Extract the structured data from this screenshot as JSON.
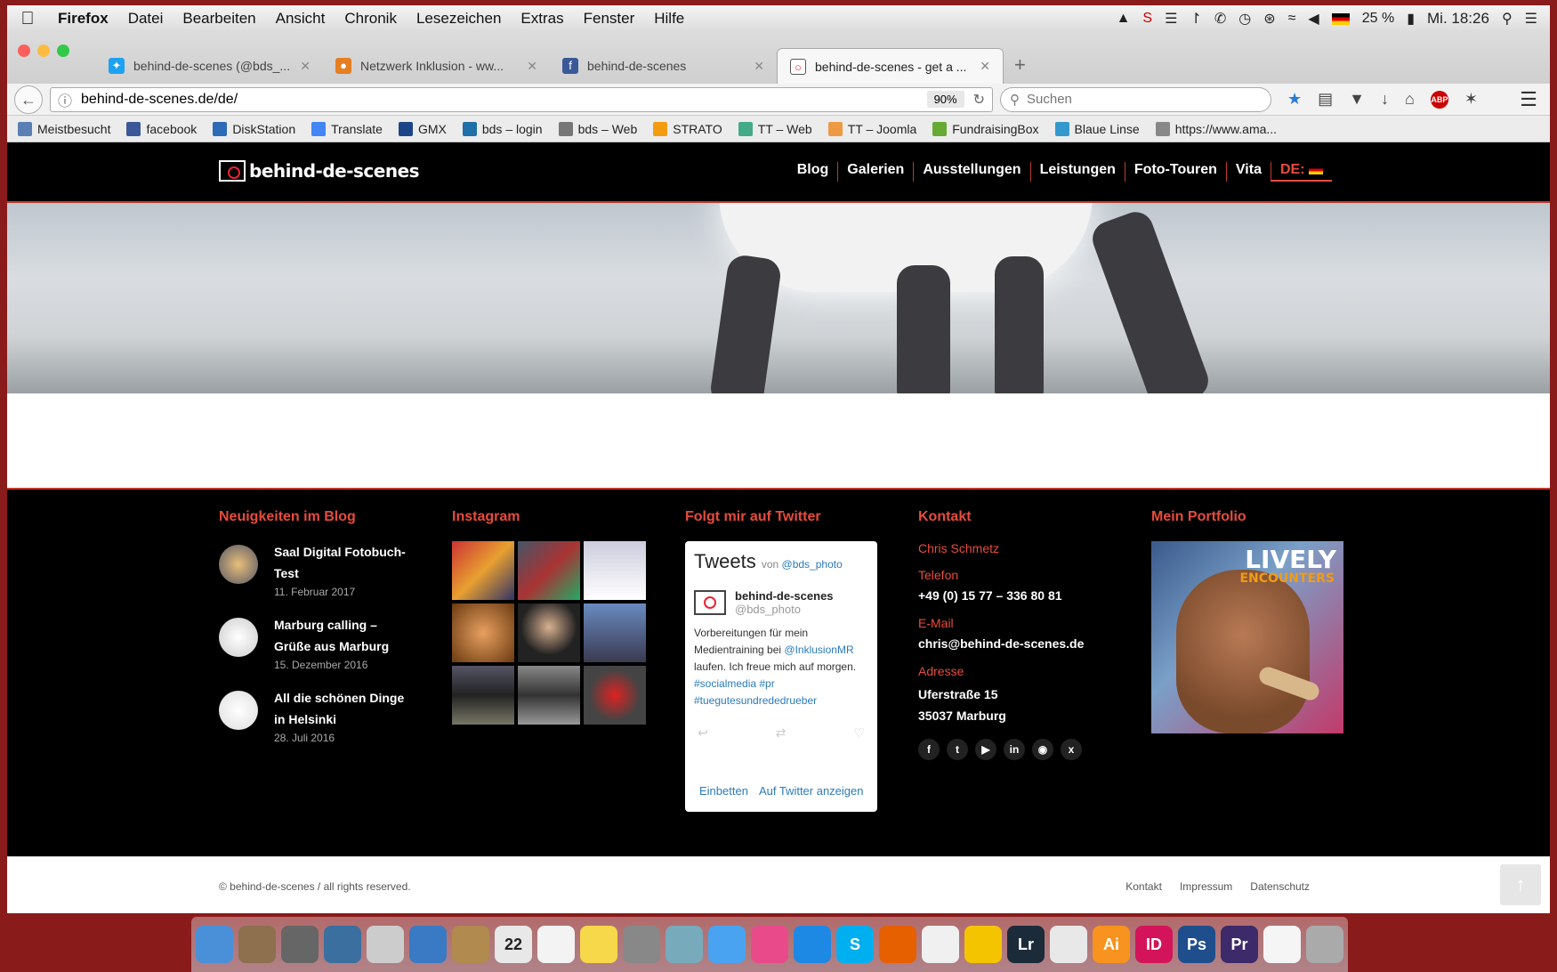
{
  "menubar": {
    "app": "Firefox",
    "items": [
      "Datei",
      "Bearbeiten",
      "Ansicht",
      "Chronik",
      "Lesezeichen",
      "Extras",
      "Fenster",
      "Hilfe"
    ],
    "battery": "25 %",
    "clock": "Mi. 18:26"
  },
  "tabs": [
    {
      "title": "behind-de-scenes (@bds_...",
      "color": "#1da1f2",
      "icon": "twitter-icon"
    },
    {
      "title": "Netzwerk Inklusion - ww...",
      "color": "#e67e22",
      "icon": "network-icon"
    },
    {
      "title": "behind-de-scenes",
      "color": "#3b5998",
      "icon": "facebook-icon"
    },
    {
      "title": "behind-de-scenes - get a ...",
      "color": "#555",
      "icon": "camera-icon",
      "active": true
    }
  ],
  "navbar": {
    "url": "behind-de-scenes.de/de/",
    "zoom": "90%",
    "search_placeholder": "Suchen"
  },
  "bookmarks": [
    {
      "label": "Meistbesucht",
      "color": "#5a7fb5"
    },
    {
      "label": "facebook",
      "color": "#3b5998"
    },
    {
      "label": "DiskStation",
      "color": "#2d6ab8"
    },
    {
      "label": "Translate",
      "color": "#4285f4"
    },
    {
      "label": "GMX",
      "color": "#1c4587"
    },
    {
      "label": "bds – login",
      "color": "#1f6fa8"
    },
    {
      "label": "bds – Web",
      "color": "#777"
    },
    {
      "label": "STRATO",
      "color": "#f39c12"
    },
    {
      "label": "TT – Web",
      "color": "#4a8"
    },
    {
      "label": "TT – Joomla",
      "color": "#e94"
    },
    {
      "label": "FundraisingBox",
      "color": "#6a3"
    },
    {
      "label": "Blaue Linse",
      "color": "#39c"
    },
    {
      "label": "https://www.ama...",
      "color": "#888"
    }
  ],
  "site": {
    "logo": "behind-de-scenes",
    "nav": [
      "Blog",
      "Galerien",
      "Ausstellungen",
      "Leistungen",
      "Foto-Touren",
      "Vita"
    ],
    "lang": "DE:"
  },
  "footer": {
    "blog_heading": "Neuigkeiten im Blog",
    "blog": [
      {
        "title": "Saal Digital Fotobuch-Test",
        "date": "11. Februar 2017"
      },
      {
        "title": "Marburg calling – Grüße aus Marburg",
        "date": "15. Dezember 2016"
      },
      {
        "title": "All die schönen Dinge in Helsinki",
        "date": "28. Juli 2016"
      }
    ],
    "instagram_heading": "Instagram",
    "twitter_heading": "Folgt mir auf Twitter",
    "twitter": {
      "title": "Tweets",
      "von": "von",
      "handle_link": "@bds_photo",
      "name": "behind-de-scenes",
      "handle": "@bds_photo",
      "text1": "Vorbereitungen für mein Medientraining bei",
      "mention": "@InklusionMR",
      "text2": "laufen. Ich freue mich auf morgen.",
      "tags": "#socialmedia #pr #tuegutesundrededrueber",
      "embed": "Einbetten",
      "view": "Auf Twitter anzeigen"
    },
    "kontakt_heading": "Kontakt",
    "kontakt": {
      "name": "Chris Schmetz",
      "tel_label": "Telefon",
      "tel": "+49 (0) 15 77 – 336 80 81",
      "mail_label": "E-Mail",
      "mail": "chris@behind-de-scenes.de",
      "addr_label": "Adresse",
      "addr1": "Uferstraße 15",
      "addr2": "35037 Marburg"
    },
    "portfolio_heading": "Mein Portfolio",
    "portfolio_title": "LIVELY",
    "portfolio_sub": "ENCOUNTERS",
    "copyright": "© behind-de-scenes / all rights reserved.",
    "links": [
      "Kontakt",
      "Impressum",
      "Datenschutz"
    ]
  },
  "dock": [
    {
      "label": "",
      "icon": "finder-icon",
      "color": "#4a90d9"
    },
    {
      "label": "",
      "icon": "photos-icon",
      "color": "#8e6f4e"
    },
    {
      "label": "",
      "icon": "launchpad-icon",
      "color": "#666"
    },
    {
      "label": "",
      "icon": "mission-control-icon",
      "color": "#3b6fa0"
    },
    {
      "label": "",
      "icon": "textedit-icon",
      "color": "#ccc"
    },
    {
      "label": "",
      "icon": "preview-icon",
      "color": "#3a7ac4"
    },
    {
      "label": "",
      "icon": "contacts-icon",
      "color": "#b08a4e"
    },
    {
      "label": "22",
      "icon": "calendar-icon",
      "color": "#e8e8e8"
    },
    {
      "label": "",
      "icon": "reminders-icon",
      "color": "#f3f3f3"
    },
    {
      "label": "",
      "icon": "notes-icon",
      "color": "#f7d84a"
    },
    {
      "label": "",
      "icon": "system-preferences-icon",
      "color": "#888"
    },
    {
      "label": "",
      "icon": "maps-icon",
      "color": "#7ab"
    },
    {
      "label": "",
      "icon": "messages-icon",
      "color": "#4aa3f0"
    },
    {
      "label": "",
      "icon": "itunes-icon",
      "color": "#e94b8a"
    },
    {
      "label": "",
      "icon": "app-store-icon",
      "color": "#1e88e5"
    },
    {
      "label": "S",
      "icon": "skype-icon",
      "color": "#00aff0"
    },
    {
      "label": "",
      "icon": "firefox-icon",
      "color": "#e66000"
    },
    {
      "label": "",
      "icon": "file-icon",
      "color": "#f0f0f0"
    },
    {
      "label": "",
      "icon": "cyberduck-icon",
      "color": "#f5c400"
    },
    {
      "label": "Lr",
      "icon": "lightroom-icon",
      "color": "#1b2b3a"
    },
    {
      "label": "",
      "icon": "acrobat-icon",
      "color": "#e8e8e8"
    },
    {
      "label": "Ai",
      "icon": "illustrator-icon",
      "color": "#f7931e"
    },
    {
      "label": "ID",
      "icon": "indesign-icon",
      "color": "#d4145a"
    },
    {
      "label": "Ps",
      "icon": "photoshop-icon",
      "color": "#1f4e8c"
    },
    {
      "label": "Pr",
      "icon": "premiere-icon",
      "color": "#3c2a6a"
    },
    {
      "label": "",
      "icon": "document-icon",
      "color": "#f5f5f5"
    },
    {
      "label": "",
      "icon": "trash-icon",
      "color": "#aaa"
    }
  ]
}
